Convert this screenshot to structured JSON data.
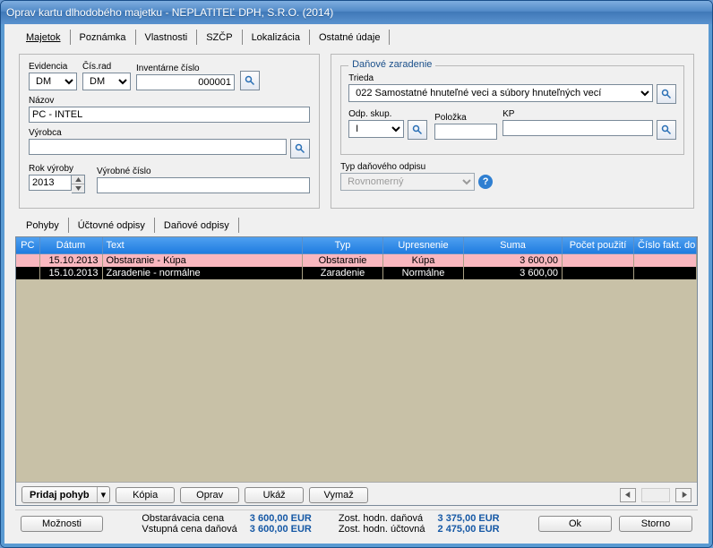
{
  "window": {
    "title": "Oprav kartu dlhodobého majetku - NEPLATITEĽ DPH, S.R.O. (2014)"
  },
  "tabs_top": [
    "Majetok",
    "Poznámka",
    "Vlastnosti",
    "SZČP",
    "Lokalizácia",
    "Ostatné údaje"
  ],
  "tabs_top_active": 0,
  "left": {
    "evidencia_label": "Evidencia",
    "evidencia": "DM",
    "cisrad_label": "Čís.rad",
    "cisrad": "DM",
    "inventarne_label": "Inventárne číslo",
    "inventarne": "000001",
    "nazov_label": "Názov",
    "nazov": "PC - INTEL",
    "vyrobca_label": "Výrobca",
    "vyrobca": "",
    "rokvyroby_label": "Rok výroby",
    "rokvyroby": "2013",
    "vyrobnecislo_label": "Výrobné číslo",
    "vyrobnecislo": ""
  },
  "right": {
    "group_label": "Daňové zaradenie",
    "trieda_label": "Trieda",
    "trieda": "022 Samostatné hnuteľné veci a súbory hnuteľných vecí",
    "odpskup_label": "Odp. skup.",
    "odpskup": "I",
    "polozka_label": "Položka",
    "polozka": "",
    "kp_label": "KP",
    "kp": "",
    "typodpisu_label": "Typ daňového odpisu",
    "typodpisu": "Rovnomerný"
  },
  "tabs_mid": [
    "Pohyby",
    "Účtovné odpisy",
    "Daňové odpisy"
  ],
  "tabs_mid_active": 0,
  "grid": {
    "headers": [
      "PC",
      "Dátum",
      "Text",
      "Typ",
      "Upresnenie",
      "Suma",
      "Počet použití",
      "Číslo fakt. dokladu"
    ],
    "rows": [
      {
        "pc": "",
        "datum": "15.10.2013",
        "text": "Obstaranie - Kúpa",
        "typ": "Obstaranie",
        "upresnenie": "Kúpa",
        "suma": "3 600,00",
        "pocet": "",
        "fakt": ""
      },
      {
        "pc": "",
        "datum": "15.10.2013",
        "text": "Zaradenie - normálne",
        "typ": "Zaradenie",
        "upresnenie": "Normálne",
        "suma": "3 600,00",
        "pocet": "",
        "fakt": ""
      }
    ]
  },
  "toolbar": {
    "pridaj": "Pridaj pohyb",
    "kopia": "Kópia",
    "oprav": "Oprav",
    "ukaz": "Ukáž",
    "vymaz": "Vymaž"
  },
  "summary": {
    "obstaravacia_l": "Obstarávacia cena",
    "obstaravacia_v": "3 600,00 EUR",
    "vstupna_l": "Vstupná cena daňová",
    "vstupna_v": "3 600,00 EUR",
    "zostdan_l": "Zost. hodn. daňová",
    "zostdan_v": "3 375,00 EUR",
    "zostuct_l": "Zost. hodn. účtovná",
    "zostuct_v": "2 475,00 EUR"
  },
  "buttons": {
    "moznosti": "Možnosti",
    "ok": "Ok",
    "storno": "Storno"
  }
}
